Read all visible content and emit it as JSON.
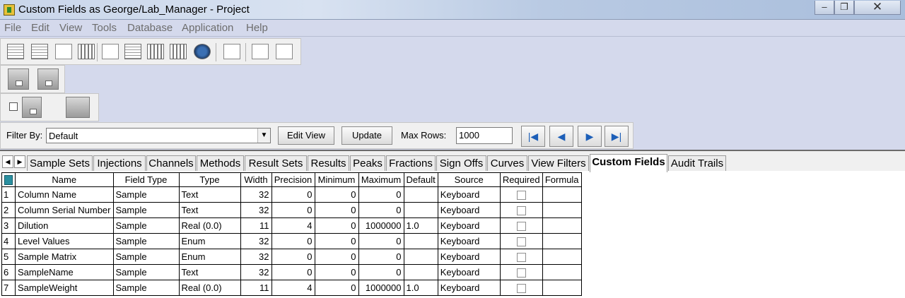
{
  "window": {
    "title": "Custom Fields as George/Lab_Manager - Project",
    "min_symbol": "–",
    "max_symbol": "❐",
    "close_symbol": "✕"
  },
  "menu": [
    "File",
    "Edit",
    "View",
    "Tools",
    "Database",
    "Application",
    "Help"
  ],
  "toolbar_icons": [
    "spreadsheet-icon",
    "table-icon",
    "preview-icon",
    "calculator-icon",
    "print-icon",
    "transfer-icon",
    "instrument-icon",
    "vials-icon",
    "globe-icon",
    "copy-icon",
    "paste-special-icon",
    "paste-icon"
  ],
  "filter": {
    "label": "Filter By:",
    "value": "Default",
    "edit_view_label": "Edit View",
    "update_label": "Update",
    "max_rows_label": "Max Rows:",
    "max_rows_value": "1000"
  },
  "nav": {
    "first": "|◀",
    "prev": "◀",
    "next": "▶",
    "last": "▶|"
  },
  "tabs": [
    "Sample Sets",
    "Injections",
    "Channels",
    "Methods",
    "Result Sets",
    "Results",
    "Peaks",
    "Fractions",
    "Sign Offs",
    "Curves",
    "View Filters",
    "Custom Fields",
    "Audit Trails"
  ],
  "active_tab": "Custom Fields",
  "table": {
    "headers": [
      "Name",
      "Field Type",
      "Type",
      "Width",
      "Precision",
      "Minimum",
      "Maximum",
      "Default",
      "Source",
      "Required",
      "Formula"
    ],
    "rows": [
      {
        "n": "1",
        "name": "Column Name",
        "field_type": "Sample",
        "type": "Text",
        "width": "32",
        "precision": "0",
        "minimum": "0",
        "maximum": "0",
        "default": "",
        "source": "Keyboard",
        "required": false,
        "formula": ""
      },
      {
        "n": "2",
        "name": "Column Serial Number",
        "field_type": "Sample",
        "type": "Text",
        "width": "32",
        "precision": "0",
        "minimum": "0",
        "maximum": "0",
        "default": "",
        "source": "Keyboard",
        "required": false,
        "formula": ""
      },
      {
        "n": "3",
        "name": "Dilution",
        "field_type": "Sample",
        "type": "Real (0.0)",
        "width": "11",
        "precision": "4",
        "minimum": "0",
        "maximum": "1000000",
        "default": "1.0",
        "source": "Keyboard",
        "required": false,
        "formula": ""
      },
      {
        "n": "4",
        "name": "Level Values",
        "field_type": "Sample",
        "type": "Enum",
        "width": "32",
        "precision": "0",
        "minimum": "0",
        "maximum": "0",
        "default": "",
        "source": "Keyboard",
        "required": false,
        "formula": ""
      },
      {
        "n": "5",
        "name": "Sample Matrix",
        "field_type": "Sample",
        "type": "Enum",
        "width": "32",
        "precision": "0",
        "minimum": "0",
        "maximum": "0",
        "default": "",
        "source": "Keyboard",
        "required": false,
        "formula": ""
      },
      {
        "n": "6",
        "name": "SampleName",
        "field_type": "Sample",
        "type": "Text",
        "width": "32",
        "precision": "0",
        "minimum": "0",
        "maximum": "0",
        "default": "",
        "source": "Keyboard",
        "required": false,
        "formula": ""
      },
      {
        "n": "7",
        "name": "SampleWeight",
        "field_type": "Sample",
        "type": "Real (0.0)",
        "width": "11",
        "precision": "4",
        "minimum": "0",
        "maximum": "1000000",
        "default": "1.0",
        "source": "Keyboard",
        "required": false,
        "formula": ""
      }
    ]
  }
}
